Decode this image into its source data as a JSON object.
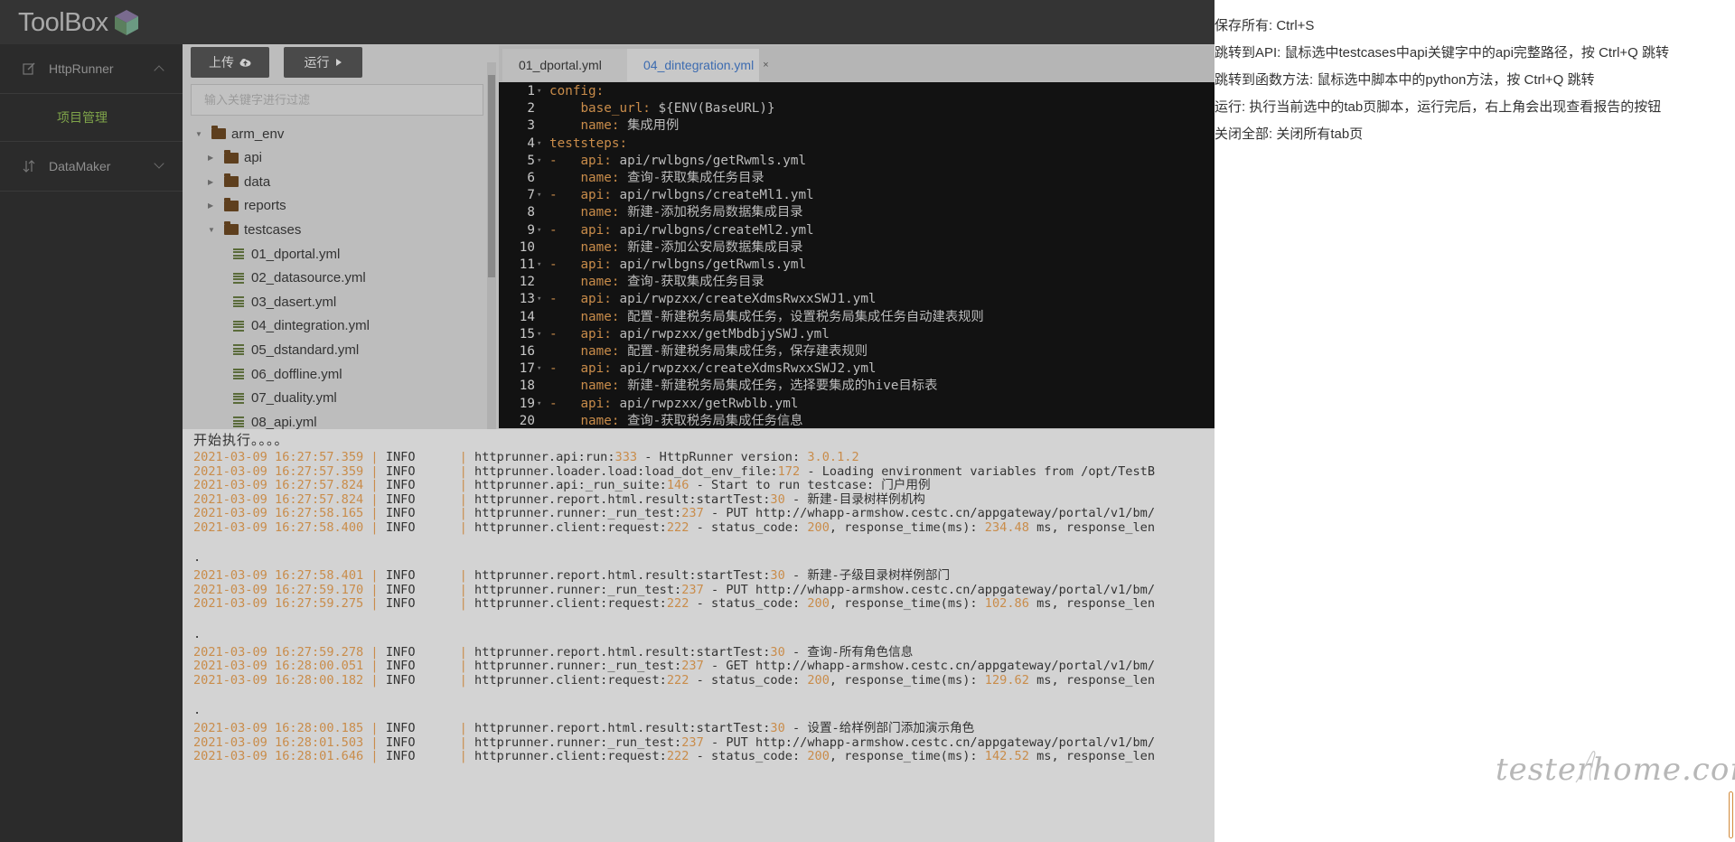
{
  "app": {
    "logo_text": "ToolBox"
  },
  "sidebar": {
    "items": [
      {
        "label": "HttpRunner",
        "icon": "edit-icon"
      },
      {
        "label": "DataMaker",
        "icon": "sort-icon"
      }
    ],
    "sub_items": [
      {
        "label": "项目管理"
      }
    ]
  },
  "toolbar": {
    "upload_label": "上传",
    "run_label": "运行"
  },
  "filter": {
    "placeholder": "输入关键字进行过滤"
  },
  "tree": {
    "nodes": [
      {
        "label": "arm_env",
        "type": "folder",
        "expanded": true
      },
      {
        "label": "api",
        "type": "folder",
        "expanded": false
      },
      {
        "label": "data",
        "type": "folder",
        "expanded": false
      },
      {
        "label": "reports",
        "type": "folder",
        "expanded": false
      },
      {
        "label": "testcases",
        "type": "folder",
        "expanded": true
      },
      {
        "label": "01_dportal.yml",
        "type": "file"
      },
      {
        "label": "02_datasource.yml",
        "type": "file"
      },
      {
        "label": "03_dasert.yml",
        "type": "file"
      },
      {
        "label": "04_dintegration.yml",
        "type": "file"
      },
      {
        "label": "05_dstandard.yml",
        "type": "file"
      },
      {
        "label": "06_doffline.yml",
        "type": "file"
      },
      {
        "label": "07_duality.yml",
        "type": "file"
      },
      {
        "label": "08_api.yml",
        "type": "file"
      }
    ]
  },
  "tabs": [
    {
      "label": "01_dportal.yml",
      "active": false
    },
    {
      "label": "04_dintegration.yml",
      "active": true,
      "close": "×"
    }
  ],
  "editor": {
    "lines": [
      {
        "no": "1",
        "fold": "▾",
        "indent": "",
        "key": "config:",
        "value": ""
      },
      {
        "no": "2",
        "fold": "",
        "indent": "    ",
        "key": "base_url:",
        "value": " ${ENV(BaseURL)}"
      },
      {
        "no": "3",
        "fold": "",
        "indent": "    ",
        "key": "name:",
        "value": " 集成用例"
      },
      {
        "no": "4",
        "fold": "▾",
        "indent": "",
        "key": "teststeps:",
        "value": ""
      },
      {
        "no": "5",
        "fold": "▾",
        "indent": "-   ",
        "key": "api:",
        "value": " api/rwlbgns/getRwmls.yml"
      },
      {
        "no": "6",
        "fold": "",
        "indent": "    ",
        "key": "name:",
        "value": " 查询-获取集成任务目录"
      },
      {
        "no": "7",
        "fold": "▾",
        "indent": "-   ",
        "key": "api:",
        "value": " api/rwlbgns/createMl1.yml"
      },
      {
        "no": "8",
        "fold": "",
        "indent": "    ",
        "key": "name:",
        "value": " 新建-添加税务局数据集成目录"
      },
      {
        "no": "9",
        "fold": "▾",
        "indent": "-   ",
        "key": "api:",
        "value": " api/rwlbgns/createMl2.yml"
      },
      {
        "no": "10",
        "fold": "",
        "indent": "    ",
        "key": "name:",
        "value": " 新建-添加公安局数据集成目录"
      },
      {
        "no": "11",
        "fold": "▾",
        "indent": "-   ",
        "key": "api:",
        "value": " api/rwlbgns/getRwmls.yml"
      },
      {
        "no": "12",
        "fold": "",
        "indent": "    ",
        "key": "name:",
        "value": " 查询-获取集成任务目录"
      },
      {
        "no": "13",
        "fold": "▾",
        "indent": "-   ",
        "key": "api:",
        "value": " api/rwpzxx/createXdmsRwxxSWJ1.yml"
      },
      {
        "no": "14",
        "fold": "",
        "indent": "    ",
        "key": "name:",
        "value": " 配置-新建税务局集成任务，设置税务局集成任务自动建表规则"
      },
      {
        "no": "15",
        "fold": "▾",
        "indent": "-   ",
        "key": "api:",
        "value": " api/rwpzxx/getMbdbjySWJ.yml"
      },
      {
        "no": "16",
        "fold": "",
        "indent": "    ",
        "key": "name:",
        "value": " 配置-新建税务局集成任务，保存建表规则"
      },
      {
        "no": "17",
        "fold": "▾",
        "indent": "-   ",
        "key": "api:",
        "value": " api/rwpzxx/createXdmsRwxxSWJ2.yml"
      },
      {
        "no": "18",
        "fold": "",
        "indent": "    ",
        "key": "name:",
        "value": " 新建-新建税务局集成任务，选择要集成的hive目标表"
      },
      {
        "no": "19",
        "fold": "▾",
        "indent": "-   ",
        "key": "api:",
        "value": " api/rwpzxx/getRwblb.yml"
      },
      {
        "no": "20",
        "fold": "",
        "indent": "    ",
        "key": "name:",
        "value": " 查询-获取税务局集成任务信息"
      }
    ]
  },
  "log": {
    "header": "开始执行。。。。",
    "entries": [
      {
        "ts": "2021-03-09 16:27:57.359",
        "level": "INFO",
        "src": "httprunner.api:run:",
        "line": "333",
        "msg": " - HttpRunner version: ",
        "num": "3.0.1.2",
        "tail": ""
      },
      {
        "ts": "2021-03-09 16:27:57.359",
        "level": "INFO",
        "src": "httprunner.loader.load:load_dot_env_file:",
        "line": "172",
        "msg": " - Loading environment variables from /opt/TestB",
        "num": "",
        "tail": ""
      },
      {
        "ts": "2021-03-09 16:27:57.824",
        "level": "INFO",
        "src": "httprunner.api:_run_suite:",
        "line": "146",
        "msg": " - Start to run testcase: 门户用例",
        "num": "",
        "tail": ""
      },
      {
        "ts": "2021-03-09 16:27:57.824",
        "level": "INFO",
        "src": "httprunner.report.html.result:startTest:",
        "line": "30",
        "msg": " - 新建-目录树样例机构",
        "num": "",
        "tail": ""
      },
      {
        "ts": "2021-03-09 16:27:58.165",
        "level": "INFO",
        "src": "httprunner.runner:_run_test:",
        "line": "237",
        "msg": " - PUT http://whapp-armshow.cestc.cn/appgateway/portal/v1/bm/",
        "num": "",
        "tail": ""
      },
      {
        "ts": "2021-03-09 16:27:58.400",
        "level": "INFO",
        "src": "httprunner.client:request:",
        "line": "222",
        "msg": " - status_code: ",
        "num": "200",
        "tail": ", response_time(ms): ",
        "num2": "234.48",
        "tail2": " ms, response_len"
      },
      {
        "dot": "."
      },
      {
        "ts": "2021-03-09 16:27:58.401",
        "level": "INFO",
        "src": "httprunner.report.html.result:startTest:",
        "line": "30",
        "msg": " - 新建-子级目录树样例部门",
        "num": "",
        "tail": ""
      },
      {
        "ts": "2021-03-09 16:27:59.170",
        "level": "INFO",
        "src": "httprunner.runner:_run_test:",
        "line": "237",
        "msg": " - PUT http://whapp-armshow.cestc.cn/appgateway/portal/v1/bm/",
        "num": "",
        "tail": ""
      },
      {
        "ts": "2021-03-09 16:27:59.275",
        "level": "INFO",
        "src": "httprunner.client:request:",
        "line": "222",
        "msg": " - status_code: ",
        "num": "200",
        "tail": ", response_time(ms): ",
        "num2": "102.86",
        "tail2": " ms, response_len"
      },
      {
        "dot": "."
      },
      {
        "ts": "2021-03-09 16:27:59.278",
        "level": "INFO",
        "src": "httprunner.report.html.result:startTest:",
        "line": "30",
        "msg": " - 查询-所有角色信息",
        "num": "",
        "tail": ""
      },
      {
        "ts": "2021-03-09 16:28:00.051",
        "level": "INFO",
        "src": "httprunner.runner:_run_test:",
        "line": "237",
        "msg": " - GET http://whapp-armshow.cestc.cn/appgateway/portal/v1/bm/",
        "num": "",
        "tail": ""
      },
      {
        "ts": "2021-03-09 16:28:00.182",
        "level": "INFO",
        "src": "httprunner.client:request:",
        "line": "222",
        "msg": " - status_code: ",
        "num": "200",
        "tail": ", response_time(ms): ",
        "num2": "129.62",
        "tail2": " ms, response_len"
      },
      {
        "dot": "."
      },
      {
        "ts": "2021-03-09 16:28:00.185",
        "level": "INFO",
        "src": "httprunner.report.html.result:startTest:",
        "line": "30",
        "msg": " - 设置-给样例部门添加演示角色",
        "num": "",
        "tail": ""
      },
      {
        "ts": "2021-03-09 16:28:01.503",
        "level": "INFO",
        "src": "httprunner.runner:_run_test:",
        "line": "237",
        "msg": " - PUT http://whapp-armshow.cestc.cn/appgateway/portal/v1/bm/",
        "num": "",
        "tail": ""
      },
      {
        "ts": "2021-03-09 16:28:01.646",
        "level": "INFO",
        "src": "httprunner.client:request:",
        "line": "222",
        "msg": " - status_code: ",
        "num": "200",
        "tail": ", response_time(ms): ",
        "num2": "142.52",
        "tail2": " ms, response_len"
      }
    ]
  },
  "help": {
    "lines": [
      "保存所有: Ctrl+S",
      "跳转到API: 鼠标选中testcases中api关键字中的api完整路径，按 Ctrl+Q 跳转",
      "跳转到函数方法: 鼠标选中脚本中的python方法，按 Ctrl+Q 跳转",
      "运行: 执行当前选中的tab页脚本，运行完后，右上角会出现查看报告的按钮",
      "关闭全部: 关闭所有tab页"
    ]
  },
  "watermark": {
    "text": "testerhome.com"
  },
  "colors": {
    "accent_green": "#7fa44a",
    "tab_active_blue": "#3c6bb0",
    "log_number_orange": "#c98c4a"
  }
}
